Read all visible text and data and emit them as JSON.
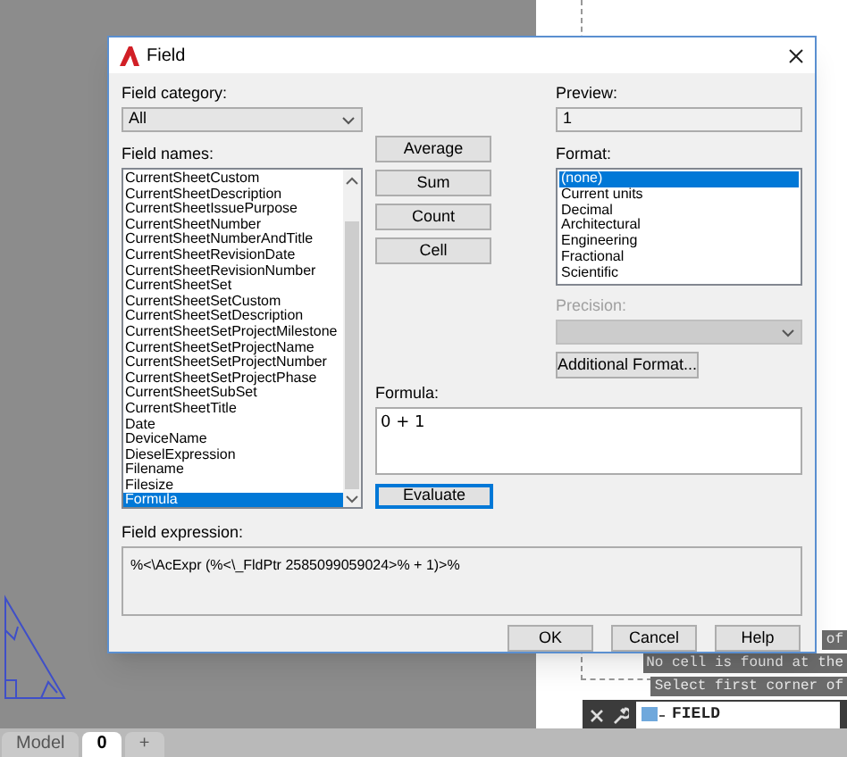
{
  "dialog": {
    "title": "Field",
    "field_category": {
      "label": "Field category:",
      "value": "All"
    },
    "field_names": {
      "label": "Field names:",
      "items": [
        {
          "name": "CurrentSheetCustom",
          "selected": false
        },
        {
          "name": "CurrentSheetDescription",
          "selected": false
        },
        {
          "name": "CurrentSheetIssuePurpose",
          "selected": false
        },
        {
          "name": "CurrentSheetNumber",
          "selected": false
        },
        {
          "name": "CurrentSheetNumberAndTitle",
          "selected": false
        },
        {
          "name": "CurrentSheetRevisionDate",
          "selected": false
        },
        {
          "name": "CurrentSheetRevisionNumber",
          "selected": false
        },
        {
          "name": "CurrentSheetSet",
          "selected": false
        },
        {
          "name": "CurrentSheetSetCustom",
          "selected": false
        },
        {
          "name": "CurrentSheetSetDescription",
          "selected": false
        },
        {
          "name": "CurrentSheetSetProjectMilestone",
          "selected": false
        },
        {
          "name": "CurrentSheetSetProjectName",
          "selected": false
        },
        {
          "name": "CurrentSheetSetProjectNumber",
          "selected": false
        },
        {
          "name": "CurrentSheetSetProjectPhase",
          "selected": false
        },
        {
          "name": "CurrentSheetSubSet",
          "selected": false
        },
        {
          "name": "CurrentSheetTitle",
          "selected": false
        },
        {
          "name": "Date",
          "selected": false
        },
        {
          "name": "DeviceName",
          "selected": false
        },
        {
          "name": "DieselExpression",
          "selected": false
        },
        {
          "name": "Filename",
          "selected": false
        },
        {
          "name": "Filesize",
          "selected": false
        },
        {
          "name": "Formula",
          "selected": true
        }
      ]
    },
    "action_buttons": [
      "Average",
      "Sum",
      "Count",
      "Cell"
    ],
    "preview": {
      "label": "Preview:",
      "value": "1"
    },
    "format": {
      "label": "Format:",
      "items": [
        {
          "name": "(none)",
          "selected": true
        },
        {
          "name": "Current units",
          "selected": false
        },
        {
          "name": "Decimal",
          "selected": false
        },
        {
          "name": "Architectural",
          "selected": false
        },
        {
          "name": "Engineering",
          "selected": false
        },
        {
          "name": "Fractional",
          "selected": false
        },
        {
          "name": "Scientific",
          "selected": false
        }
      ]
    },
    "precision": {
      "label": "Precision:",
      "disabled": true
    },
    "additional_format": "Additional Format...",
    "formula": {
      "label": "Formula:",
      "value": "0 + 1"
    },
    "evaluate": {
      "label": "Evaluate",
      "focused": true
    },
    "field_expression": {
      "label": "Field expression:",
      "value": "%<\\AcExpr (%<\\_FldPtr 2585099059024>% + 1)>%"
    },
    "footer_buttons": [
      "OK",
      "Cancel",
      "Help"
    ]
  },
  "command_history": [
    "of",
    "No cell is found at the",
    "Select first corner of"
  ],
  "command_line": {
    "value": "FIELD"
  },
  "layout_tabs": [
    {
      "label": "Model",
      "selected": false
    },
    {
      "label": "0",
      "selected": true
    },
    {
      "label": "+",
      "selected": false
    }
  ]
}
